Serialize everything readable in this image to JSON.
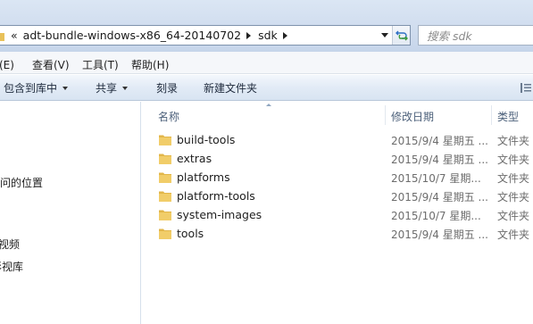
{
  "address_bar": {
    "overflow_chevron": "«",
    "breadcrumbs": [
      {
        "label": "adt-bundle-windows-x86_64-20140702"
      },
      {
        "label": "sdk"
      }
    ],
    "refresh_icon": "refresh-arrows-icon"
  },
  "search": {
    "placeholder": "搜索 sdk"
  },
  "menu": {
    "items": [
      {
        "label": "编辑(E)",
        "visible_label": "辑(E)"
      },
      {
        "label": "查看(V)"
      },
      {
        "label": "工具(T)"
      },
      {
        "label": "帮助(H)"
      }
    ]
  },
  "toolbar": {
    "include_in_library": "包含到库中",
    "share": "共享",
    "burn": "刻录",
    "new_folder": "新建文件夹"
  },
  "nav_pane": {
    "items": [
      {
        "label": "访问的位置",
        "visible_label": "访问的位置"
      },
      {
        "label": "视频"
      },
      {
        "label": "影视库",
        "visible_label": "影视库"
      }
    ]
  },
  "columns": {
    "name": "名称",
    "modified": "修改日期",
    "type": "类型"
  },
  "files": [
    {
      "name": "build-tools",
      "modified": "2015/9/4 星期五 ...",
      "type": "文件夹"
    },
    {
      "name": "extras",
      "modified": "2015/9/4 星期五 ...",
      "type": "文件夹"
    },
    {
      "name": "platforms",
      "modified": "2015/10/7 星期...",
      "type": "文件夹"
    },
    {
      "name": "platform-tools",
      "modified": "2015/9/4 星期五 ...",
      "type": "文件夹"
    },
    {
      "name": "system-images",
      "modified": "2015/10/7 星期...",
      "type": "文件夹"
    },
    {
      "name": "tools",
      "modified": "2015/9/4 星期五 ...",
      "type": "文件夹"
    }
  ],
  "colors": {
    "folder_yellow": "#e8c15a",
    "header_text": "#4c607a",
    "meta_text": "#6d6d6d"
  }
}
